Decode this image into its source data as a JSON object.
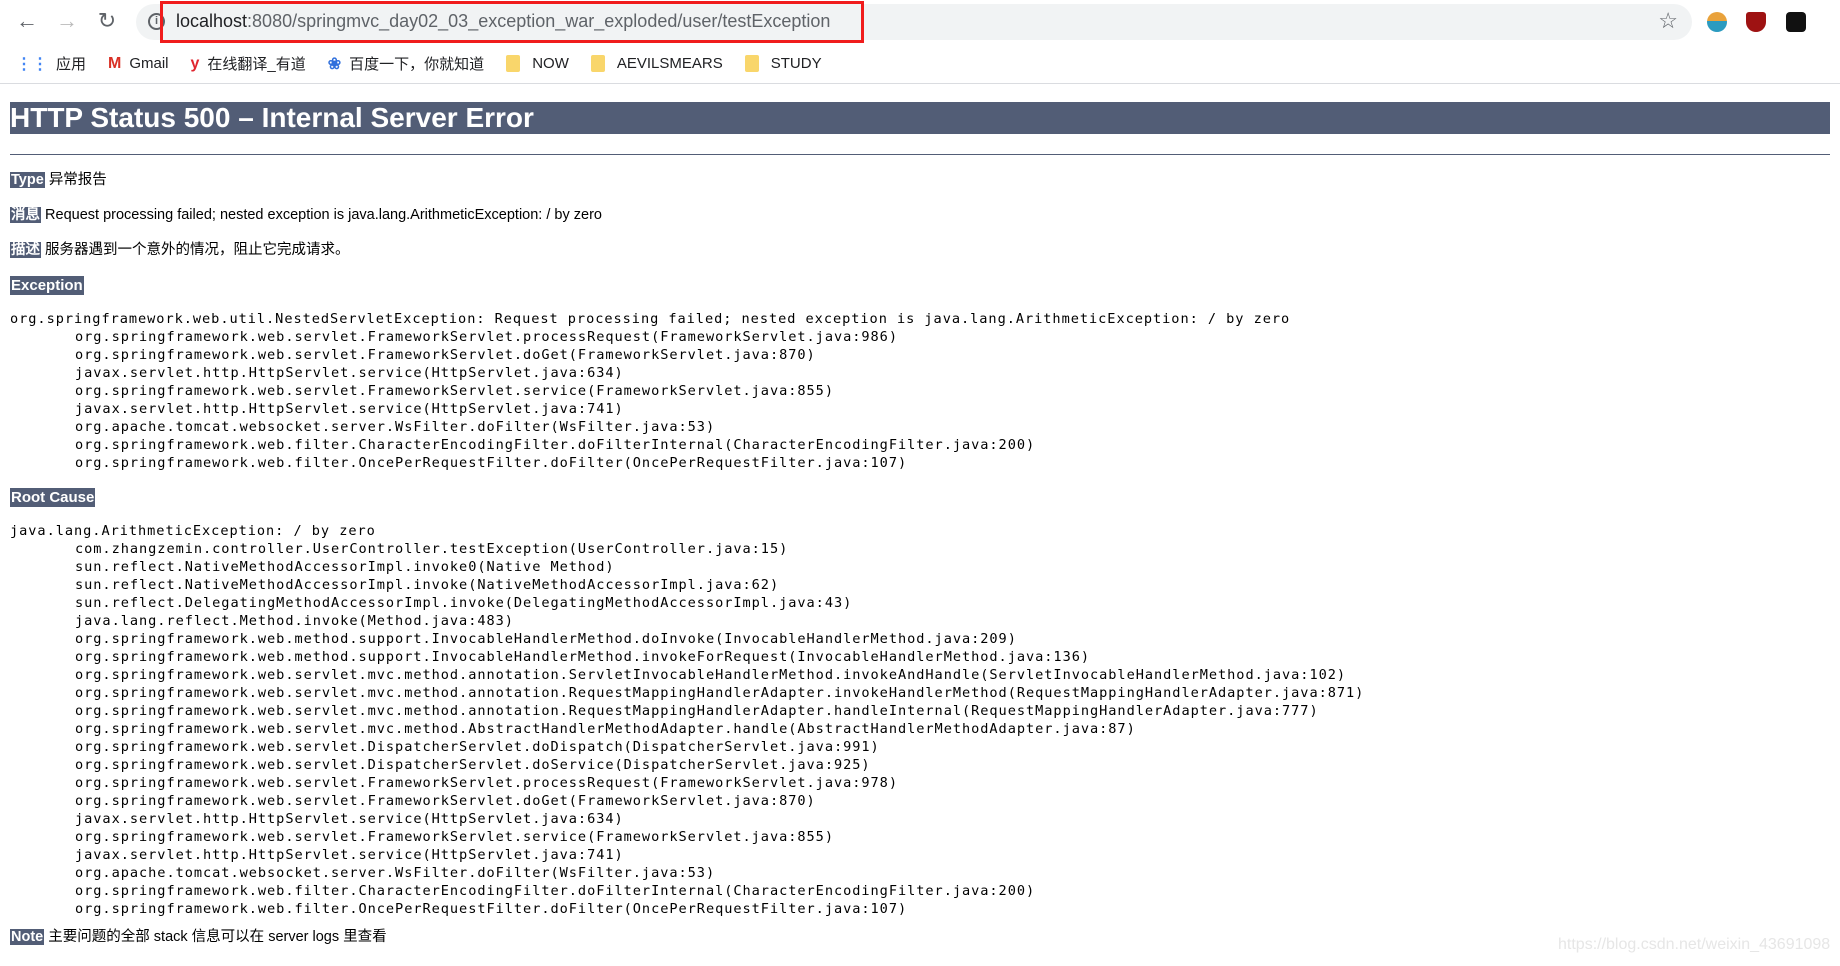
{
  "browser": {
    "url_host": "localhost",
    "url_rest": ":8080/springmvc_day02_03_exception_war_exploded/user/testException",
    "bookmarks": [
      {
        "label": "应用",
        "icon": "apps-grid-icon"
      },
      {
        "label": "Gmail",
        "icon": "gmail-icon"
      },
      {
        "label": "在线翻译_有道",
        "icon": "youdao-icon"
      },
      {
        "label": "百度一下，你就知道",
        "icon": "baidu-paw-icon"
      },
      {
        "label": "NOW",
        "icon": "folder-icon"
      },
      {
        "label": "AEVILSMEARS",
        "icon": "folder-icon"
      },
      {
        "label": "STUDY",
        "icon": "folder-icon"
      }
    ]
  },
  "page": {
    "title": "HTTP Status 500 – Internal Server Error",
    "type_label": "Type",
    "type_value": "异常报告",
    "message_label": "消息",
    "message_value": "Request processing failed; nested exception is java.lang.ArithmeticException: / by zero",
    "desc_label": "描述",
    "desc_value": "服务器遇到一个意外的情况，阻止它完成请求。",
    "exception_heading": "Exception",
    "exception_head": "org.springframework.web.util.NestedServletException: Request processing failed; nested exception is java.lang.ArithmeticException: / by zero",
    "exception_frames": [
      "org.springframework.web.servlet.FrameworkServlet.processRequest(FrameworkServlet.java:986)",
      "org.springframework.web.servlet.FrameworkServlet.doGet(FrameworkServlet.java:870)",
      "javax.servlet.http.HttpServlet.service(HttpServlet.java:634)",
      "org.springframework.web.servlet.FrameworkServlet.service(FrameworkServlet.java:855)",
      "javax.servlet.http.HttpServlet.service(HttpServlet.java:741)",
      "org.apache.tomcat.websocket.server.WsFilter.doFilter(WsFilter.java:53)",
      "org.springframework.web.filter.CharacterEncodingFilter.doFilterInternal(CharacterEncodingFilter.java:200)",
      "org.springframework.web.filter.OncePerRequestFilter.doFilter(OncePerRequestFilter.java:107)"
    ],
    "root_heading": "Root Cause",
    "root_head": "java.lang.ArithmeticException: / by zero",
    "root_frames": [
      "com.zhangzemin.controller.UserController.testException(UserController.java:15)",
      "sun.reflect.NativeMethodAccessorImpl.invoke0(Native Method)",
      "sun.reflect.NativeMethodAccessorImpl.invoke(NativeMethodAccessorImpl.java:62)",
      "sun.reflect.DelegatingMethodAccessorImpl.invoke(DelegatingMethodAccessorImpl.java:43)",
      "java.lang.reflect.Method.invoke(Method.java:483)",
      "org.springframework.web.method.support.InvocableHandlerMethod.doInvoke(InvocableHandlerMethod.java:209)",
      "org.springframework.web.method.support.InvocableHandlerMethod.invokeForRequest(InvocableHandlerMethod.java:136)",
      "org.springframework.web.servlet.mvc.method.annotation.ServletInvocableHandlerMethod.invokeAndHandle(ServletInvocableHandlerMethod.java:102)",
      "org.springframework.web.servlet.mvc.method.annotation.RequestMappingHandlerAdapter.invokeHandlerMethod(RequestMappingHandlerAdapter.java:871)",
      "org.springframework.web.servlet.mvc.method.annotation.RequestMappingHandlerAdapter.handleInternal(RequestMappingHandlerAdapter.java:777)",
      "org.springframework.web.servlet.mvc.method.AbstractHandlerMethodAdapter.handle(AbstractHandlerMethodAdapter.java:87)",
      "org.springframework.web.servlet.DispatcherServlet.doDispatch(DispatcherServlet.java:991)",
      "org.springframework.web.servlet.DispatcherServlet.doService(DispatcherServlet.java:925)",
      "org.springframework.web.servlet.FrameworkServlet.processRequest(FrameworkServlet.java:978)",
      "org.springframework.web.servlet.FrameworkServlet.doGet(FrameworkServlet.java:870)",
      "javax.servlet.http.HttpServlet.service(HttpServlet.java:634)",
      "org.springframework.web.servlet.FrameworkServlet.service(FrameworkServlet.java:855)",
      "javax.servlet.http.HttpServlet.service(HttpServlet.java:741)",
      "org.apache.tomcat.websocket.server.WsFilter.doFilter(WsFilter.java:53)",
      "org.springframework.web.filter.CharacterEncodingFilter.doFilterInternal(CharacterEncodingFilter.java:200)",
      "org.springframework.web.filter.OncePerRequestFilter.doFilter(OncePerRequestFilter.java:107)"
    ],
    "note_label": "Note",
    "note_value": "主要问题的全部 stack 信息可以在 server logs 里查看",
    "watermark": "https://blog.csdn.net/weixin_43691098"
  }
}
